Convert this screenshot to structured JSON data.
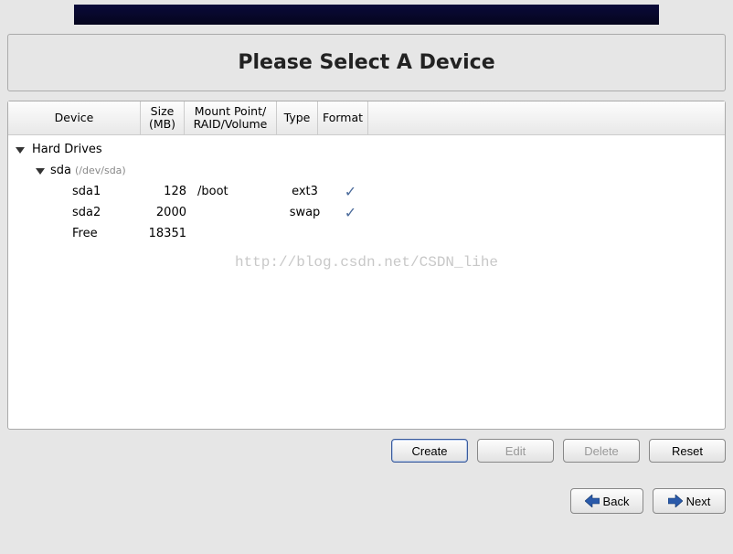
{
  "title": "Please Select A Device",
  "columns": {
    "device": "Device",
    "size": "Size (MB)",
    "mount": "Mount Point/ RAID/Volume",
    "type": "Type",
    "format": "Format"
  },
  "tree": {
    "rootLabel": "Hard Drives",
    "disk": {
      "name": "sda",
      "path": "(/dev/sda)"
    },
    "partitions": [
      {
        "name": "sda1",
        "size": "128",
        "mount": "/boot",
        "type": "ext3",
        "format": true
      },
      {
        "name": "sda2",
        "size": "2000",
        "mount": "",
        "type": "swap",
        "format": true
      },
      {
        "name": "Free",
        "size": "18351",
        "mount": "",
        "type": "",
        "format": false
      }
    ]
  },
  "watermark": "http://blog.csdn.net/CSDN_lihe",
  "buttons": {
    "create": "Create",
    "edit": "Edit",
    "delete": "Delete",
    "reset": "Reset",
    "back": "Back",
    "next": "Next"
  }
}
